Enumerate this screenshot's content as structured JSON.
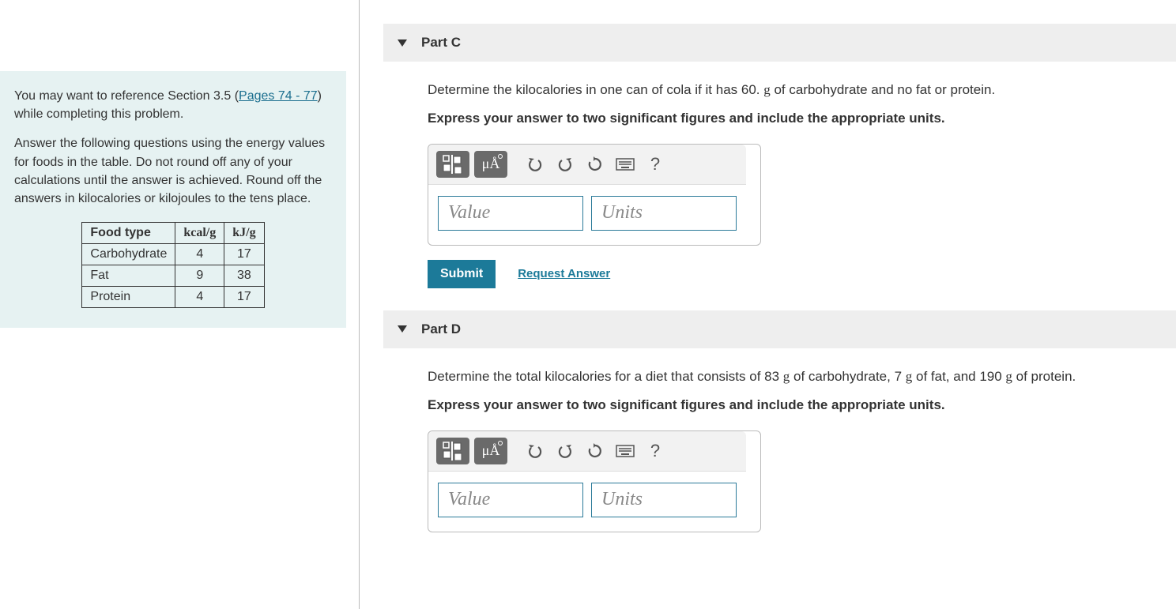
{
  "intro": {
    "ref_pre": "You may want to reference Section 3.5 (",
    "ref_link": "Pages 74 - 77",
    "ref_post": ") while completing this problem.",
    "instructions": "Answer the following questions using the energy values for foods in the table. Do not round off any of your calculations until the answer is achieved. Round off the answers in kilocalories or kilojoules to the tens place."
  },
  "table": {
    "headers": {
      "food": "Food type",
      "kcal": "kcal/g",
      "kj": "kJ/g"
    },
    "rows": [
      {
        "food": "Carbohydrate",
        "kcal": "4",
        "kj": "17"
      },
      {
        "food": "Fat",
        "kcal": "9",
        "kj": "38"
      },
      {
        "food": "Protein",
        "kcal": "4",
        "kj": "17"
      }
    ]
  },
  "parts": {
    "c": {
      "title": "Part C",
      "prompt_pre": "Determine the kilocalories in one can of cola if it has 60. ",
      "prompt_g": "g",
      "prompt_post": " of carbohydrate and no fat or protein.",
      "instruct": "Express your answer to two significant figures and include the appropriate units.",
      "value_ph": "Value",
      "units_ph": "Units",
      "submit": "Submit",
      "request": "Request Answer"
    },
    "d": {
      "title": "Part D",
      "prompt": "Determine the total kilocalories for a diet that consists of 83 g of carbohydrate, 7 g of fat, and 190 g of protein.",
      "instruct": "Express your answer to two significant figures and include the appropriate units.",
      "value_ph": "Value",
      "units_ph": "Units"
    }
  },
  "toolbar": {
    "special_chars": "μÅ",
    "help": "?"
  }
}
